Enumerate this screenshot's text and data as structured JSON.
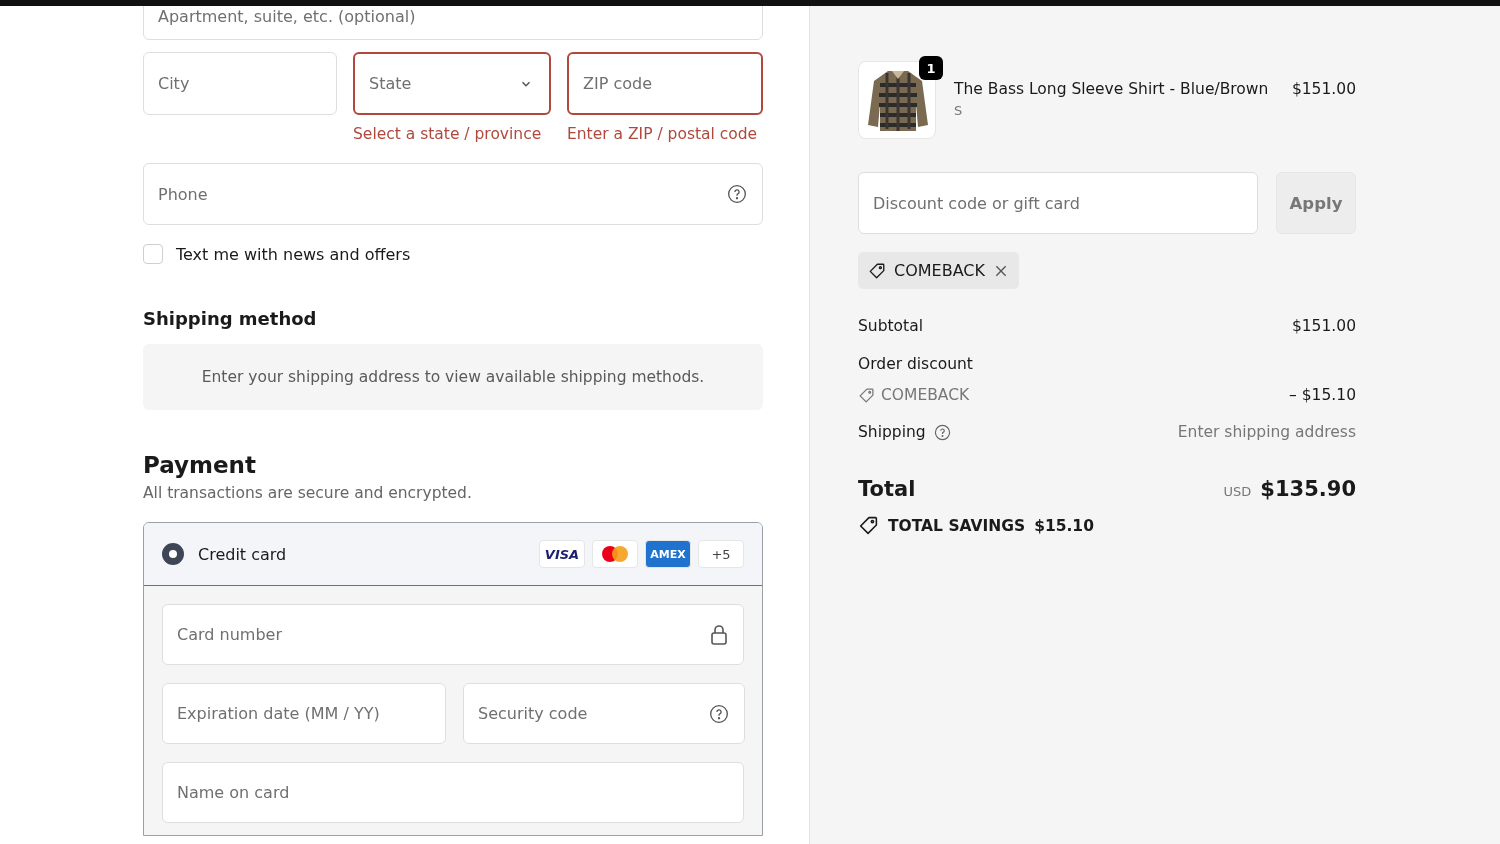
{
  "address": {
    "apartment": {
      "placeholder": "Apartment, suite, etc. (optional)"
    },
    "city": {
      "placeholder": "City",
      "error": false
    },
    "state": {
      "placeholder": "State",
      "error": true,
      "message": "Select a state / province"
    },
    "zip": {
      "placeholder": "ZIP code",
      "error": true,
      "message": "Enter a ZIP / postal code"
    },
    "phone": {
      "placeholder": "Phone"
    },
    "sms_opt_in": {
      "label": "Text me with news and offers",
      "checked": false
    }
  },
  "shipping_method": {
    "title": "Shipping method",
    "notice": "Enter your shipping address to view available shipping methods."
  },
  "payment": {
    "title": "Payment",
    "subtitle": "All transactions are secure and encrypted.",
    "methods": [
      {
        "label": "Credit card",
        "selected": true,
        "brands": [
          {
            "kind": "visa",
            "label": "VISA"
          },
          {
            "kind": "mastercard"
          },
          {
            "kind": "amex",
            "label": "AMEX"
          },
          {
            "kind": "more",
            "label": "+5"
          }
        ]
      }
    ],
    "card_number": {
      "placeholder": "Card number"
    },
    "expiration": {
      "placeholder": "Expiration date (MM / YY)"
    },
    "security_code": {
      "placeholder": "Security code"
    },
    "name_on_card": {
      "placeholder": "Name on card"
    }
  },
  "summary": {
    "items": [
      {
        "quantity": "1",
        "name": "The Bass Long Sleeve Shirt - Blue/Brown",
        "variant": "S",
        "price": "$151.00"
      }
    ],
    "discount": {
      "placeholder": "Discount code or gift card",
      "button": "Apply"
    },
    "applied_codes": [
      "COMEBACK"
    ],
    "subtotal": {
      "label": "Subtotal",
      "value": "$151.00"
    },
    "order_discount": {
      "label": "Order discount",
      "code": "COMEBACK",
      "value": "– $15.10"
    },
    "shipping": {
      "label": "Shipping",
      "value": "Enter shipping address"
    },
    "total": {
      "label": "Total",
      "currency": "USD",
      "value": "$135.90"
    },
    "savings": {
      "label": "TOTAL SAVINGS",
      "value": "$15.10"
    }
  }
}
